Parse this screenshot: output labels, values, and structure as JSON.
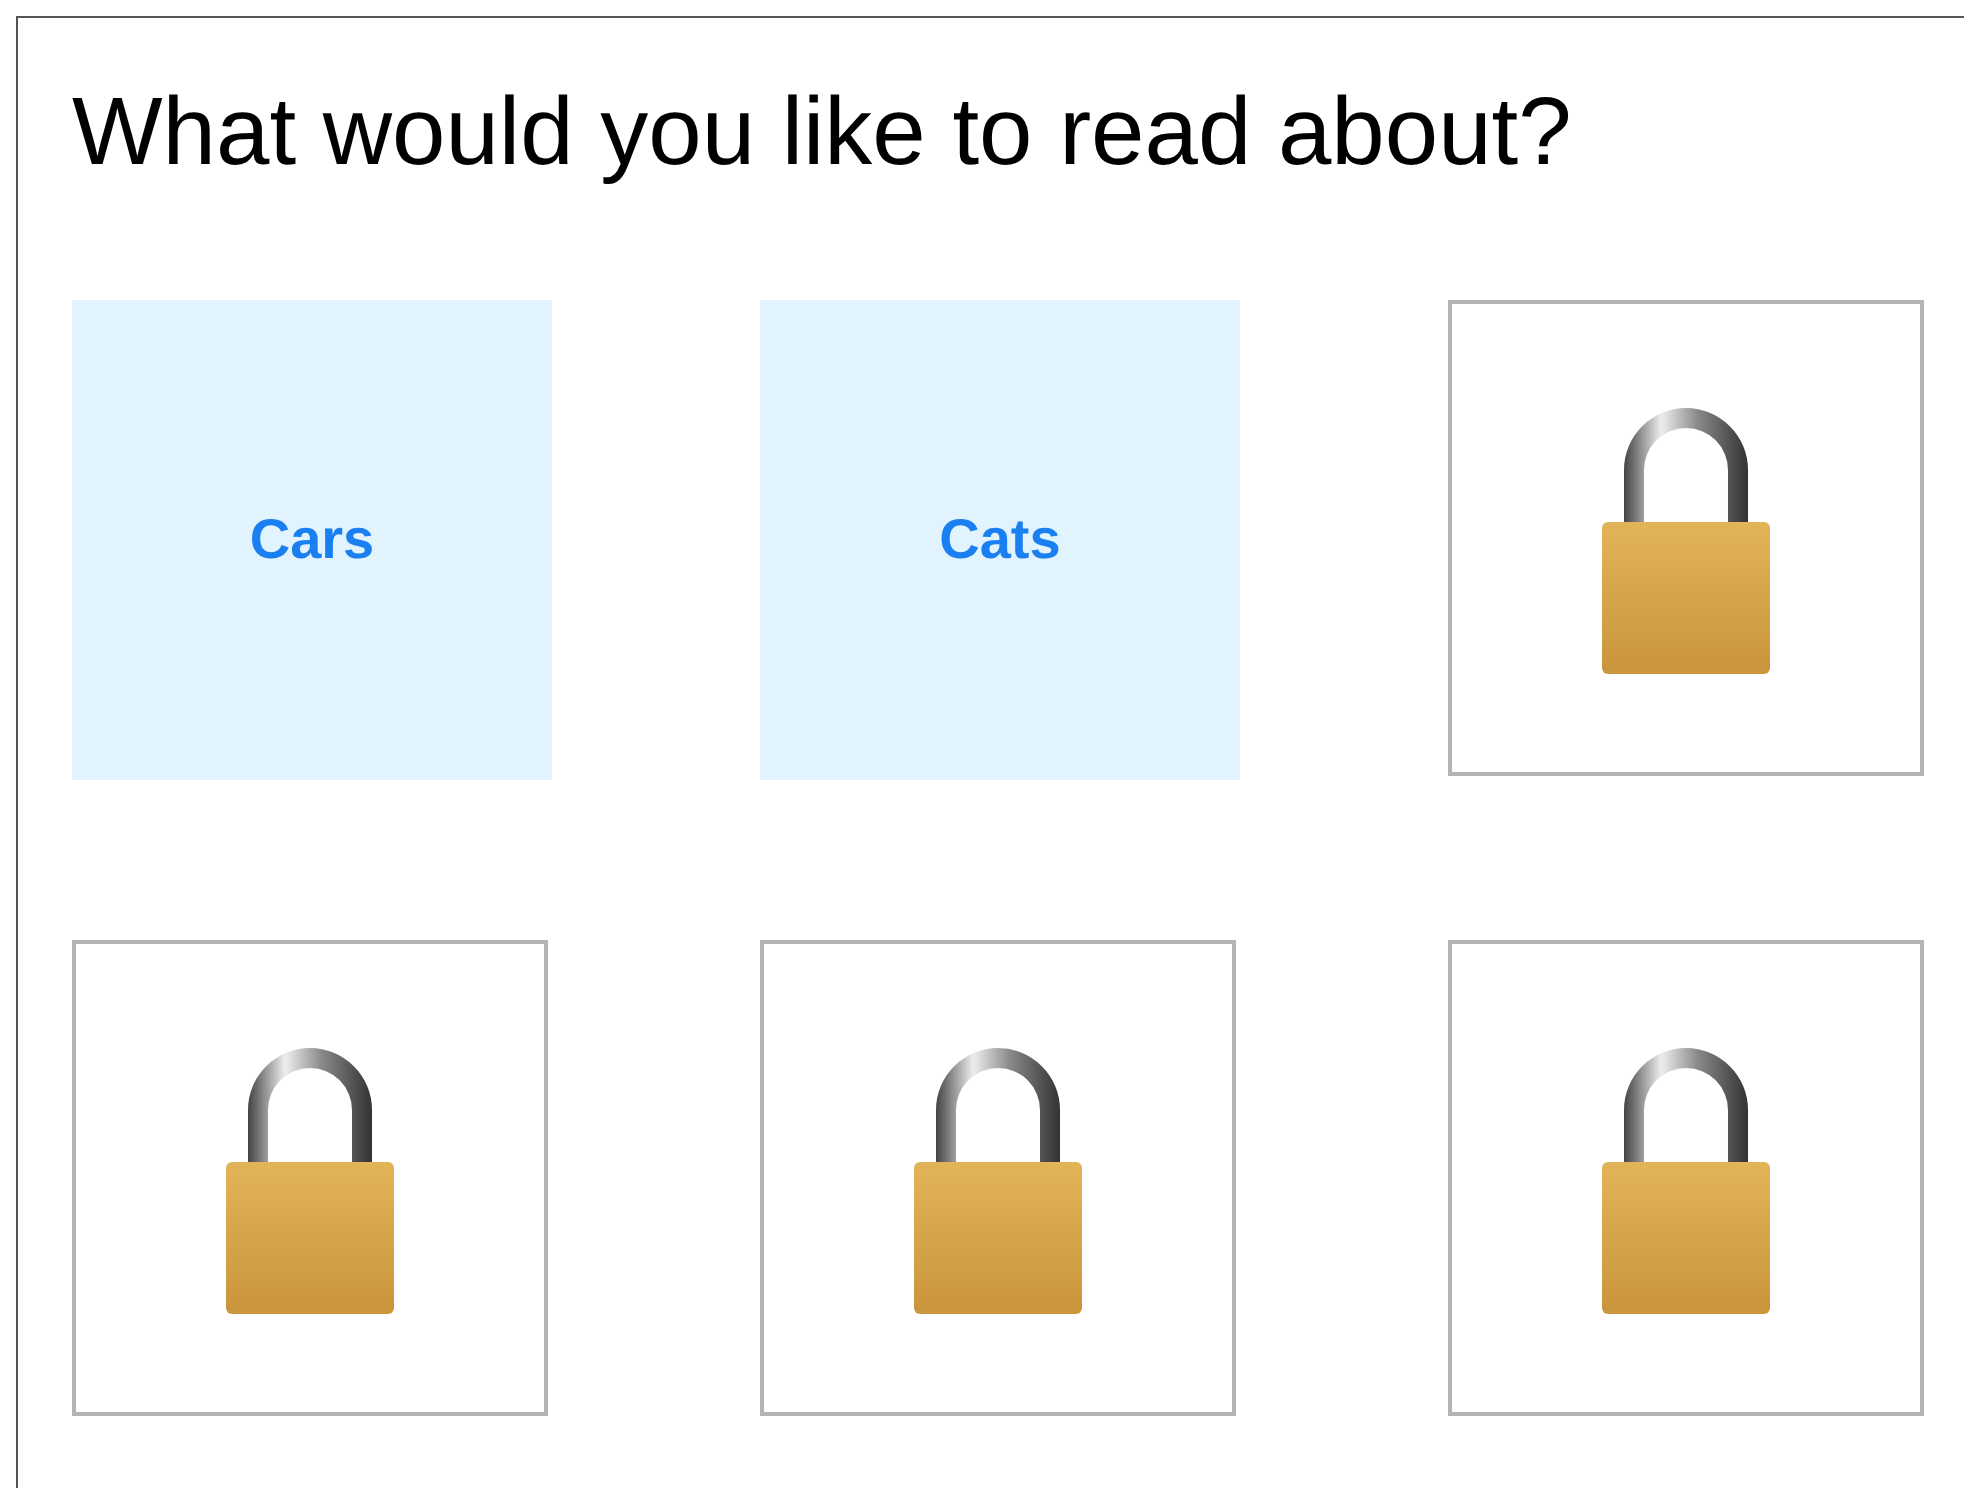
{
  "heading": "What would you like to read about?",
  "tiles": [
    {
      "kind": "topic",
      "label": "Cars"
    },
    {
      "kind": "topic",
      "label": "Cats"
    },
    {
      "kind": "locked"
    },
    {
      "kind": "locked"
    },
    {
      "kind": "locked"
    },
    {
      "kind": "locked"
    }
  ]
}
